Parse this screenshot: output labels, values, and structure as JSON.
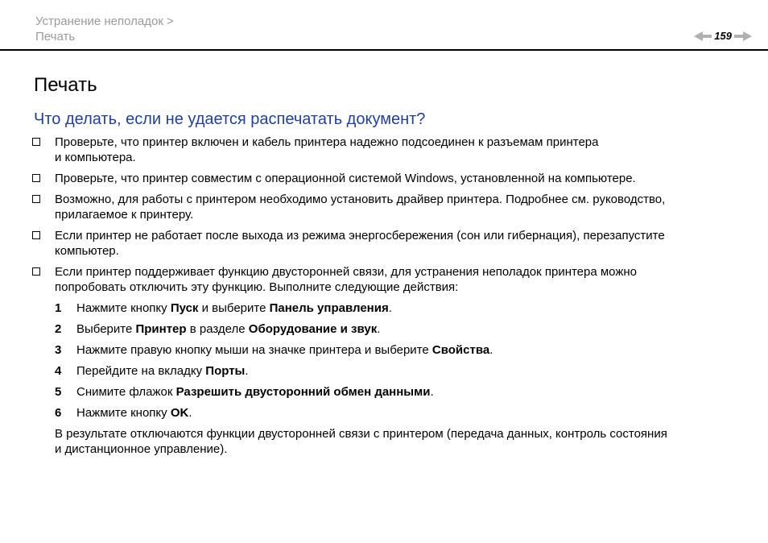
{
  "header": {
    "breadcrumb_section": "Устранение неполадок >",
    "breadcrumb_page": "Печать",
    "page_number": "159"
  },
  "title": "Печать",
  "subtitle": "Что делать, если не удается распечатать документ?",
  "bullets": [
    {
      "line1": "Проверьте, что принтер включен и кабель принтера надежно подсоединен к разъемам принтера",
      "line2": "и компьютера."
    },
    {
      "line1": "Проверьте, что принтер совместим с операционной системой Windows, установленной на компьютере.",
      "line2": ""
    },
    {
      "line1": "Возможно, для работы с принтером необходимо установить драйвер принтера. Подробнее см. руководство,",
      "line2": "прилагаемое к принтеру."
    },
    {
      "line1": "Если принтер не работает после выхода из режима энергосбережения (сон или гибернация), перезапустите",
      "line2": "компьютер."
    },
    {
      "line1": "Если принтер поддерживает функцию двусторонней связи, для устранения неполадок принтера можно",
      "line2": "попробовать отключить эту функцию. Выполните следующие действия:"
    }
  ],
  "steps": [
    {
      "num": "1",
      "a": "Нажмите кнопку ",
      "b1": "Пуск",
      "c": " и выберите ",
      "b2": "Панель управления",
      "d": "."
    },
    {
      "num": "2",
      "a": "Выберите ",
      "b1": "Принтер",
      "c": " в разделе ",
      "b2": "Оборудование и звук",
      "d": "."
    },
    {
      "num": "3",
      "a": "Нажмите правую кнопку мыши на значке принтера и выберите ",
      "b1": "Свойства",
      "c": "",
      "b2": "",
      "d": "."
    },
    {
      "num": "4",
      "a": "Перейдите на вкладку ",
      "b1": "Порты",
      "c": "",
      "b2": "",
      "d": "."
    },
    {
      "num": "5",
      "a": "Снимите флажок ",
      "b1": "Разрешить двусторонний обмен данными",
      "c": "",
      "b2": "",
      "d": "."
    },
    {
      "num": "6",
      "a": "Нажмите кнопку ",
      "b1": "OK",
      "c": "",
      "b2": "",
      "d": "."
    }
  ],
  "note": {
    "line1": "В результате отключаются функции двусторонней связи с принтером (передача данных, контроль состояния",
    "line2": "и дистанционное управление)."
  },
  "colors": {
    "subtitle": "#1f3fa8",
    "breadcrumb": "#9a9a9a",
    "pager_arrows": "#b0b0b0"
  },
  "icons": {
    "prev": "left-triangle-arrow",
    "next": "right-triangle-arrow",
    "bullet": "square-bullet"
  }
}
